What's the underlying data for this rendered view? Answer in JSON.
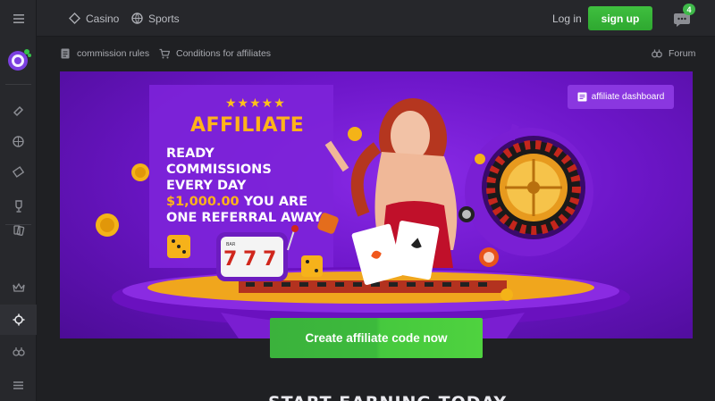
{
  "topbar": {
    "nav": [
      {
        "label": "Casino",
        "icon": "casino-icon"
      },
      {
        "label": "Sports",
        "icon": "sports-icon"
      }
    ],
    "login_label": "Log in",
    "signup_label": "sign up",
    "chat_badge": "4"
  },
  "subbar": {
    "commission_rules": "commission rules",
    "conditions": "Conditions for affiliates",
    "forum": "Forum"
  },
  "hero": {
    "title": "AFFILIATE",
    "line1": "READY",
    "line2": "COMMISSIONS",
    "line3": "EVERY DAY",
    "amount": "$1,000.00",
    "line4_rest": " YOU ARE",
    "line5": "ONE REFERRAL AWAY",
    "dashboard_label": "affiliate dashboard",
    "slot_label": "BAR"
  },
  "cta_label": "Create affiliate code now",
  "section_heading": "START EARNING TODAY",
  "colors": {
    "accent_green": "#3cba3c",
    "brand_purple": "#6d16c9",
    "gold": "#ffb31a"
  }
}
